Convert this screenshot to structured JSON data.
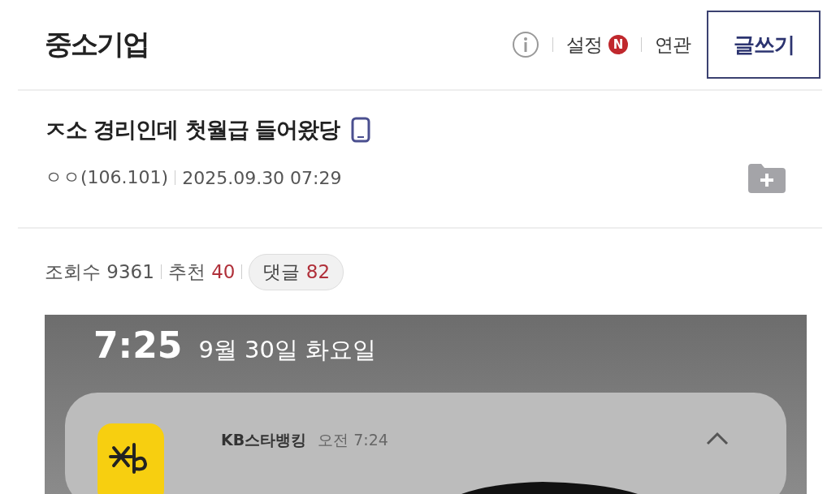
{
  "board": {
    "title": "중소기업",
    "settings_label": "설정",
    "settings_badge": "N",
    "related_label": "연관",
    "write_button": "글쓰기"
  },
  "post": {
    "title": "ㅈ소 경리인데 첫월급 들어왔당",
    "author": "ㅇㅇ(106.101)",
    "date": "2025.09.30 07:29"
  },
  "stats": [
    {
      "label": "조회수",
      "value": "9361",
      "kind": "plain"
    },
    {
      "label": "추천",
      "value": "40",
      "kind": "plain"
    },
    {
      "label": "댓글",
      "value": "82",
      "kind": "pill"
    }
  ],
  "lock_screen": {
    "time": "7:25",
    "date": "9월 30일 화요일",
    "notification": {
      "app": "KB스타뱅킹",
      "time": "오전 7:24",
      "expanded": true
    }
  }
}
